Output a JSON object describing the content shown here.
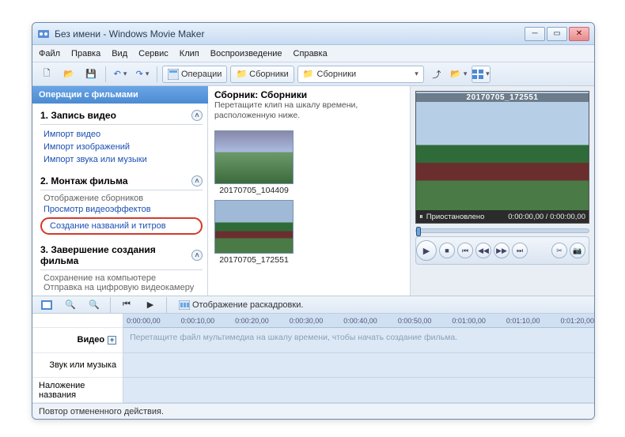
{
  "window": {
    "title": "Без имени - Windows Movie Maker"
  },
  "menu": {
    "file": "Файл",
    "edit": "Правка",
    "view": "Вид",
    "service": "Сервис",
    "clip": "Клип",
    "playback": "Воспроизведение",
    "help": "Справка"
  },
  "toolbar": {
    "operations_label": "Операции",
    "collections_label": "Сборники",
    "collections_select_label": "Сборники"
  },
  "tasks": {
    "header": "Операции с фильмами",
    "s1": {
      "title": "1. Запись видео",
      "import_video": "Импорт видео",
      "import_images": "Импорт изображений",
      "import_audio": "Импорт звука или музыки"
    },
    "s2": {
      "title": "2. Монтаж фильма",
      "show_collections": "Отображение сборников",
      "view_effects": "Просмотр видеоэффектов",
      "make_titles": "Создание названий и титров"
    },
    "s3": {
      "title": "3. Завершение создания фильма",
      "save_pc": "Сохранение на компьютере",
      "send_dv": "Отправка на цифровую видеокамеру"
    }
  },
  "collection": {
    "title": "Сборник: Сборники",
    "subtitle": "Перетащите клип на шкалу времени, расположенную ниже.",
    "items": [
      {
        "caption": "20170705_104409"
      },
      {
        "caption": "20170705_172551"
      }
    ]
  },
  "preview": {
    "clip_title": "20170705_172551",
    "status_label": "Приостановлено",
    "time": "0:00:00,00 / 0:00:00,00"
  },
  "timeline": {
    "mode_label": "Отображение раскадровки.",
    "ruler": [
      "0:00:00,00",
      "0:00:10,00",
      "0:00:20,00",
      "0:00:30,00",
      "0:00:40,00",
      "0:00:50,00",
      "0:01:00,00",
      "0:01:10,00",
      "0:01:20,00"
    ],
    "tracks": {
      "video": "Видео",
      "audio": "Звук или музыка",
      "title": "Наложение названия"
    },
    "hint": "Перетащите файл мультимедиа на шкалу времени, чтобы начать создание фильма."
  },
  "statusbar": {
    "text": "Повтор отмененного действия."
  }
}
